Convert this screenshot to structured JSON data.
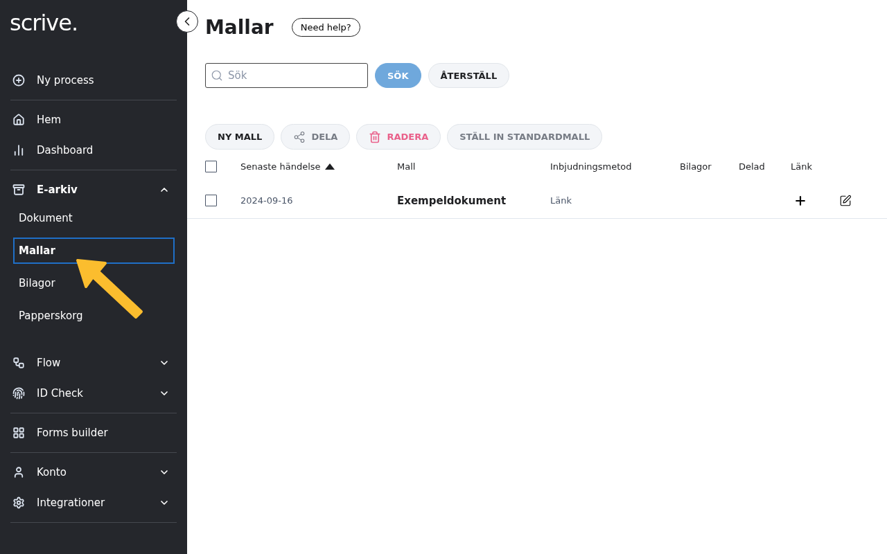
{
  "logo": "scrive.",
  "sidebar": {
    "sections": [
      [
        {
          "label": "Ny process"
        }
      ],
      [
        {
          "label": "Hem"
        },
        {
          "label": "Dashboard"
        }
      ],
      [
        {
          "label": "E-arkiv",
          "expanded": true,
          "children": [
            {
              "label": "Dokument",
              "selected": false
            },
            {
              "label": "Mallar",
              "selected": true
            },
            {
              "label": "Bilagor",
              "selected": false
            },
            {
              "label": "Papperskorg",
              "selected": false
            }
          ]
        },
        {
          "label": "Flow",
          "expanded": false
        },
        {
          "label": "ID Check",
          "expanded": false
        }
      ],
      [
        {
          "label": "Forms builder"
        }
      ],
      [
        {
          "label": "Konto",
          "expanded": false
        },
        {
          "label": "Integrationer",
          "expanded": false
        }
      ]
    ]
  },
  "header": {
    "title": "Mallar",
    "help": "Need help?"
  },
  "search": {
    "placeholder": "Sök",
    "buttons": [
      {
        "label": "SÖK",
        "kind": "primary"
      },
      {
        "label": "ÅTERSTÄLL",
        "kind": "secondary"
      }
    ]
  },
  "actions": [
    {
      "label": "NY MALL",
      "kind": "plain",
      "disabled": false
    },
    {
      "label": "DELA",
      "kind": "share",
      "disabled": true
    },
    {
      "label": "RADERA",
      "kind": "delete",
      "disabled": true
    },
    {
      "label": "STÄLL IN STANDARDMALL",
      "kind": "plain",
      "disabled": true
    }
  ],
  "table": {
    "columns": [
      {
        "label": "Senaste händelse",
        "sorted": true
      },
      {
        "label": "Mall",
        "sorted": false
      },
      {
        "label": "Inbjudningsmetod",
        "sorted": false
      },
      {
        "label": "Bilagor",
        "sorted": false
      },
      {
        "label": "Delad",
        "sorted": false
      },
      {
        "label": "Länk",
        "sorted": false
      }
    ],
    "header_checked": false,
    "rows": [
      {
        "checked": false,
        "date": "2024-09-16",
        "name": "Exempeldokument",
        "method": "Länk"
      }
    ]
  }
}
